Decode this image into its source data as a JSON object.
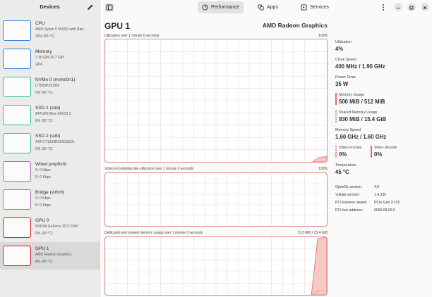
{
  "sidebar": {
    "title": "Devices",
    "items": [
      {
        "name": "CPU",
        "sub1": "AMD Ryzen 5 5600G with Rad...",
        "sub2": "35% (55 °C)",
        "color": "#3584e4"
      },
      {
        "name": "Memory",
        "sub1": "7.36 GiB 30.7 GiB",
        "sub2": "24%",
        "color": "#3584e4"
      },
      {
        "name": "NVMe 0 (nvme0n1)",
        "sub1": "CT500P3SSD8",
        "sub2": "0% (40 °C)",
        "color": "#2ec27e"
      },
      {
        "name": "SSD 1 (sda)",
        "sub1": "ATA WD Blue SA510 2.",
        "sub2": "6% (36 °C)",
        "color": "#2ec27e"
      },
      {
        "name": "SSD 2 (sdb)",
        "sub1": "ATA CT1000BX500SSD1",
        "sub2": "0% (36 °C)",
        "color": "#2ec27e"
      },
      {
        "name": "Wired (enp5s0)",
        "sub1": "S: 0 Kbps",
        "sub2": "R: 0 Kbps",
        "color": "#c061cb"
      },
      {
        "name": "Bridge (virbr0)",
        "sub1": "S: 0 Kbps",
        "sub2": "R: 0 Kbps",
        "color": "#c061cb"
      },
      {
        "name": "GPU 0",
        "sub1": "NVIDIA GeForce RTX 3060",
        "sub2": "0% (43 °C)",
        "color": "#e01b24"
      },
      {
        "name": "GPU 1",
        "sub1": "AMD Radeon Graphics",
        "sub2": "4% (45 °C)",
        "color": "#e01b24"
      }
    ]
  },
  "topbar": {
    "tabs": [
      {
        "label": "Performance",
        "icon": "gauge-icon"
      },
      {
        "label": "Apps",
        "icon": "apps-icon"
      },
      {
        "label": "Services",
        "icon": "services-icon"
      }
    ]
  },
  "main": {
    "title": "GPU 1",
    "model": "AMD Radeon Graphics",
    "graphs": [
      {
        "label": "Utilization over 1 minute 0 seconds",
        "max": "100%"
      },
      {
        "label": "Video encode/decode utilization over 1 minute 0 seconds",
        "max": "100%"
      },
      {
        "label": "Dedicated and shared memory usage over 1 minute 0 seconds",
        "max": "512 MiB / 15.4 GiB"
      }
    ]
  },
  "stats": {
    "utilization": {
      "label": "Utilization",
      "value": "4%"
    },
    "clock": {
      "label": "Clock Speed",
      "value": "400 MHz / 1.90 GHz"
    },
    "power": {
      "label": "Power Draw",
      "value": "35 W"
    },
    "memory": {
      "label": "Memory Usage",
      "value": "500 MiB / 512 MiB"
    },
    "shared": {
      "label": "Shared Memory Usage",
      "value": "930 MiB / 15.4 GiB"
    },
    "memspeed": {
      "label": "Memory Speed",
      "value": "1.60 GHz / 1.60 GHz"
    },
    "venc": {
      "label": "Video encode",
      "value": "0%"
    },
    "vdec": {
      "label": "Video decode",
      "value": "0%"
    },
    "temp": {
      "label": "Temperature",
      "value": "45 °C"
    }
  },
  "info": [
    {
      "key": "OpenGL version:",
      "value": "4.6"
    },
    {
      "key": "Vulkan version:",
      "value": "1.4.335"
    },
    {
      "key": "PCI Express speed:",
      "value": "PCIe Gen 3 x16"
    },
    {
      "key": "PCI bus address:",
      "value": "0000:08:00.0"
    }
  ],
  "colors": {
    "graph_line": "#e06c66",
    "graph_fill": "#f7c9c5",
    "grid": "#f0d8d6",
    "selected_bg": "#d9d9d9"
  }
}
